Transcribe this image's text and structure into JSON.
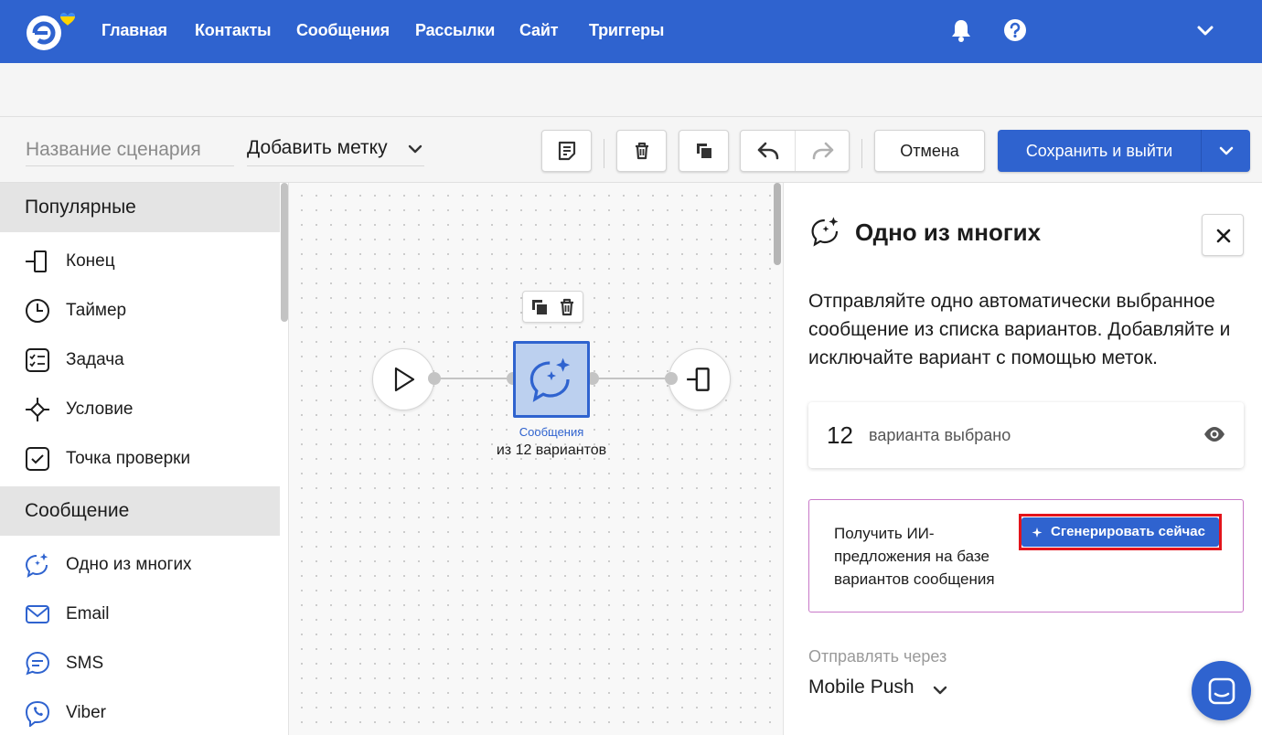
{
  "nav": {
    "items": [
      "Главная",
      "Контакты",
      "Сообщения",
      "Рассылки",
      "Сайт",
      "Триггеры"
    ],
    "icons": [
      "bell-icon",
      "help-icon",
      "chevron-down-icon"
    ]
  },
  "toolbar": {
    "scenario_name_placeholder": "Название сценария",
    "tag_label": "Добавить метку",
    "cancel_label": "Отмена",
    "save_label": "Сохранить и выйти"
  },
  "sidebar": {
    "sections": [
      {
        "title": "Популярные",
        "items": [
          {
            "label": "Конец",
            "icon": "end-icon"
          },
          {
            "label": "Таймер",
            "icon": "timer-icon"
          },
          {
            "label": "Задача",
            "icon": "task-icon"
          },
          {
            "label": "Условие",
            "icon": "condition-icon"
          },
          {
            "label": "Точка проверки",
            "icon": "checkpoint-icon"
          }
        ]
      },
      {
        "title": "Сообщение",
        "items": [
          {
            "label": "Одно из многих",
            "icon": "ai-chat-icon"
          },
          {
            "label": "Email",
            "icon": "email-icon"
          },
          {
            "label": "SMS",
            "icon": "sms-icon"
          },
          {
            "label": "Viber",
            "icon": "viber-icon"
          }
        ]
      }
    ]
  },
  "canvas": {
    "node_subtitle": "Сообщения",
    "node_caption": "из 12 вариантов"
  },
  "panel": {
    "title": "Одно из многих",
    "description": "Отправляйте одно автоматически выбранное сообщение из списка вариантов. Добавляйте и исключайте вариант с помощью меток.",
    "variants_count": "12",
    "variants_label": "варианта выбрано",
    "ai_text": "Получить ИИ-предложения на базе вариантов сообщения",
    "ai_button": "Сгенерировать сейчас",
    "send_via_label": "Отправлять через",
    "send_via_value": "Mobile Push"
  },
  "colors": {
    "brand": "#2f63cf",
    "highlight": "#e3141b",
    "ai_border": "#c879c8"
  }
}
